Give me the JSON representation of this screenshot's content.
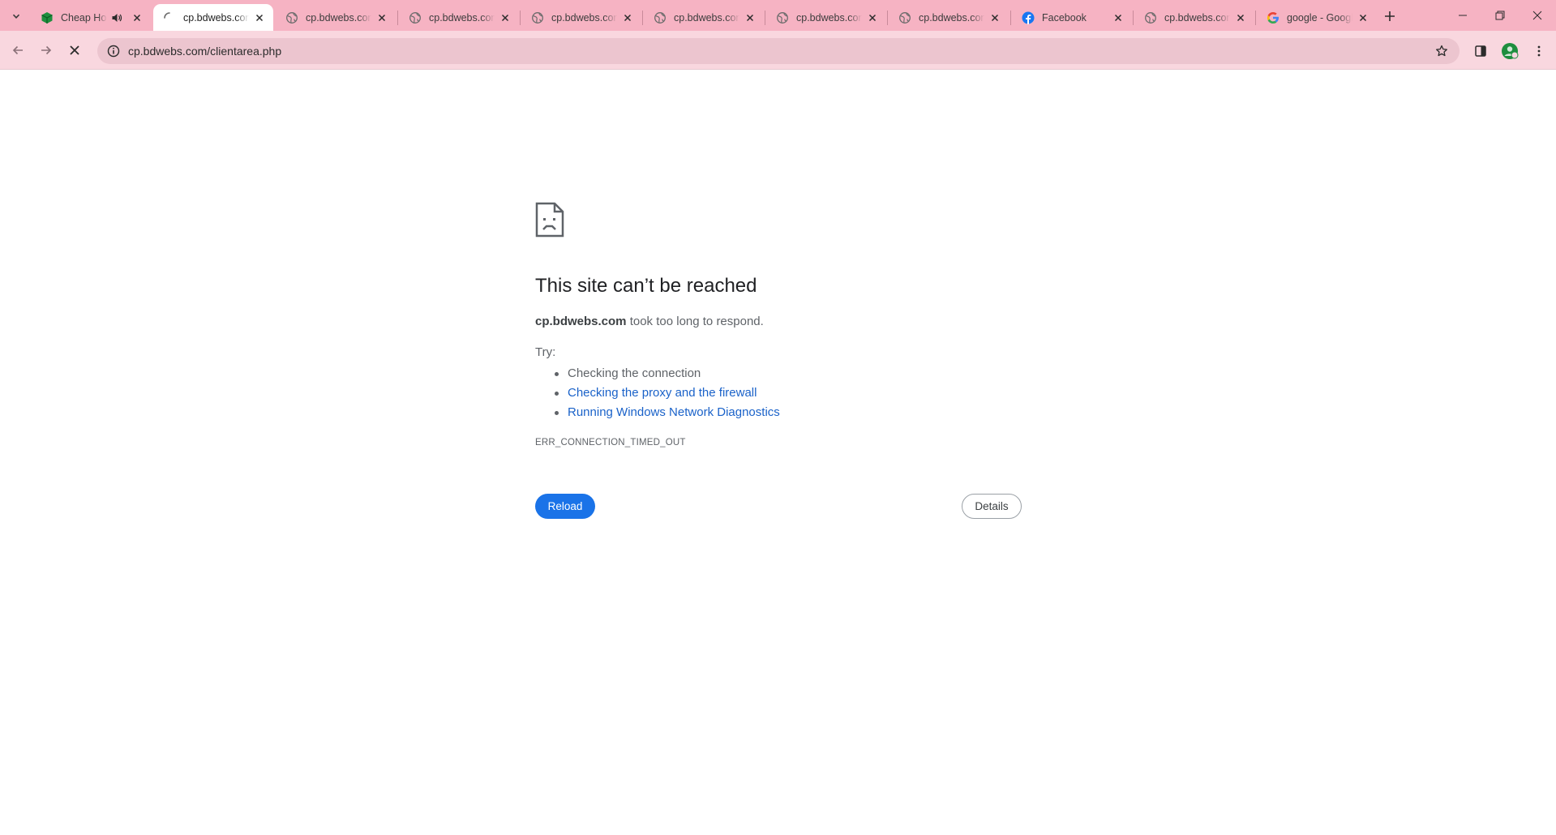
{
  "browser": {
    "tabs": [
      {
        "title": "Cheap Hosting",
        "favicon": "cube-icon",
        "audio": true,
        "active": false,
        "loading": false
      },
      {
        "title": "cp.bdwebs.com",
        "favicon": "loading-spinner-icon",
        "audio": false,
        "active": true,
        "loading": true
      },
      {
        "title": "cp.bdwebs.com",
        "favicon": "globe-icon",
        "audio": false,
        "active": false,
        "loading": false
      },
      {
        "title": "cp.bdwebs.com",
        "favicon": "globe-icon",
        "audio": false,
        "active": false,
        "loading": false
      },
      {
        "title": "cp.bdwebs.com",
        "favicon": "globe-icon",
        "audio": false,
        "active": false,
        "loading": false
      },
      {
        "title": "cp.bdwebs.com",
        "favicon": "globe-icon",
        "audio": false,
        "active": false,
        "loading": false
      },
      {
        "title": "cp.bdwebs.com",
        "favicon": "globe-icon",
        "audio": false,
        "active": false,
        "loading": false
      },
      {
        "title": "cp.bdwebs.com",
        "favicon": "globe-icon",
        "audio": false,
        "active": false,
        "loading": false
      },
      {
        "title": "Facebook",
        "favicon": "facebook-icon",
        "audio": false,
        "active": false,
        "loading": false
      },
      {
        "title": "cp.bdwebs.com",
        "favicon": "globe-icon",
        "audio": false,
        "active": false,
        "loading": false
      },
      {
        "title": "google - Google Search",
        "favicon": "google-icon",
        "audio": false,
        "active": false,
        "loading": false
      }
    ],
    "url": "cp.bdwebs.com/clientarea.php",
    "theme_color": "#f6b3c3"
  },
  "error_page": {
    "heading": "This site can’t be reached",
    "host": "cp.bdwebs.com",
    "summary_suffix": " took too long to respond.",
    "try_label": "Try:",
    "suggestions": [
      {
        "text": "Checking the connection",
        "link": false
      },
      {
        "text": "Checking the proxy and the firewall",
        "link": true
      },
      {
        "text": "Running Windows Network Diagnostics",
        "link": true
      }
    ],
    "error_code": "ERR_CONNECTION_TIMED_OUT",
    "reload_label": "Reload",
    "details_label": "Details",
    "accent_color": "#1a73e8",
    "link_color": "#1a62c9"
  }
}
